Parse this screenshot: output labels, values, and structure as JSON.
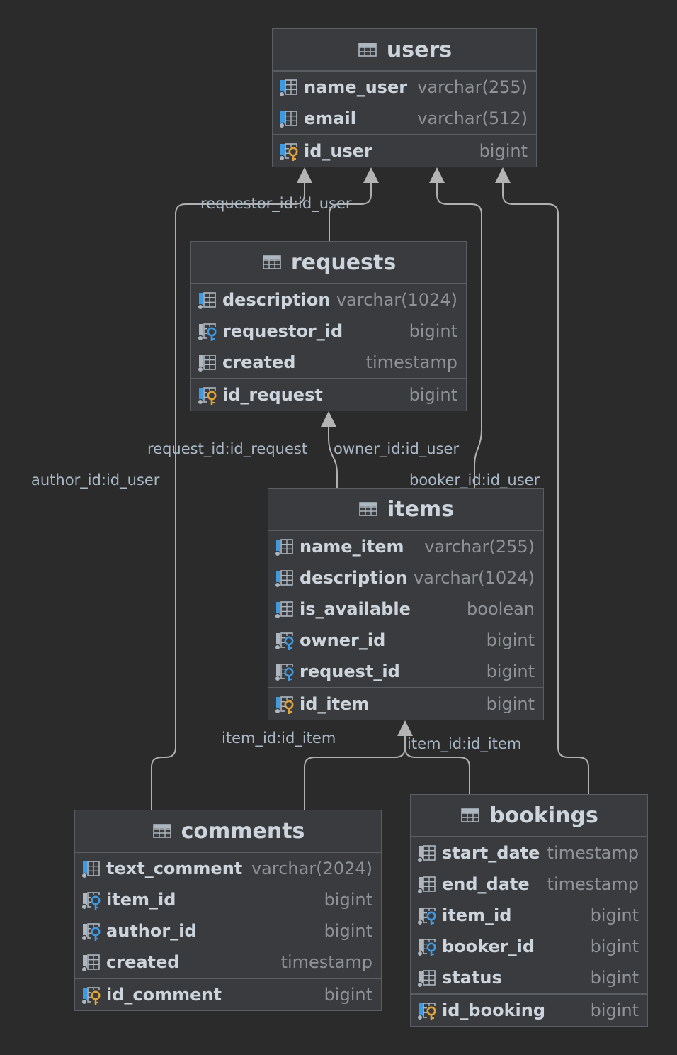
{
  "tables": {
    "users": {
      "title": "users",
      "columns": [
        {
          "name": "name_user",
          "type": "varchar(255)",
          "kind": "column"
        },
        {
          "name": "email",
          "type": "varchar(512)",
          "kind": "column"
        }
      ],
      "pk": {
        "name": "id_user",
        "type": "bigint"
      }
    },
    "requests": {
      "title": "requests",
      "columns": [
        {
          "name": "description",
          "type": "varchar(1024)",
          "kind": "column"
        },
        {
          "name": "requestor_id",
          "type": "bigint",
          "kind": "fk"
        },
        {
          "name": "created",
          "type": "timestamp",
          "kind": "plain"
        }
      ],
      "pk": {
        "name": "id_request",
        "type": "bigint"
      }
    },
    "items": {
      "title": "items",
      "columns": [
        {
          "name": "name_item",
          "type": "varchar(255)",
          "kind": "column"
        },
        {
          "name": "description",
          "type": "varchar(1024)",
          "kind": "column"
        },
        {
          "name": "is_available",
          "type": "boolean",
          "kind": "column"
        },
        {
          "name": "owner_id",
          "type": "bigint",
          "kind": "fk"
        },
        {
          "name": "request_id",
          "type": "bigint",
          "kind": "fk"
        }
      ],
      "pk": {
        "name": "id_item",
        "type": "bigint"
      }
    },
    "comments": {
      "title": "comments",
      "columns": [
        {
          "name": "text_comment",
          "type": "varchar(2024)",
          "kind": "column"
        },
        {
          "name": "item_id",
          "type": "bigint",
          "kind": "fk"
        },
        {
          "name": "author_id",
          "type": "bigint",
          "kind": "fk"
        },
        {
          "name": "created",
          "type": "timestamp",
          "kind": "plain"
        }
      ],
      "pk": {
        "name": "id_comment",
        "type": "bigint"
      }
    },
    "bookings": {
      "title": "bookings",
      "columns": [
        {
          "name": "start_date",
          "type": "timestamp",
          "kind": "plain"
        },
        {
          "name": "end_date",
          "type": "timestamp",
          "kind": "plain"
        },
        {
          "name": "item_id",
          "type": "bigint",
          "kind": "fk"
        },
        {
          "name": "booker_id",
          "type": "bigint",
          "kind": "fk"
        },
        {
          "name": "status",
          "type": "bigint",
          "kind": "plain"
        }
      ],
      "pk": {
        "name": "id_booking",
        "type": "bigint"
      }
    }
  },
  "relations": {
    "requestor": "requestor_id:id_user",
    "request": "request_id:id_request",
    "owner": "owner_id:id_user",
    "author": "author_id:id_user",
    "booker": "booker_id:id_user",
    "comment_item": "item_id:id_item",
    "booking_item": "item_id:id_item"
  },
  "colors": {
    "background": "#2b2b2b",
    "table_fill": "#393b3e",
    "border": "#5a5d61",
    "wire": "#b4b4b4",
    "fk_key": "#3f9ae0",
    "pk_key": "#e0a338"
  }
}
